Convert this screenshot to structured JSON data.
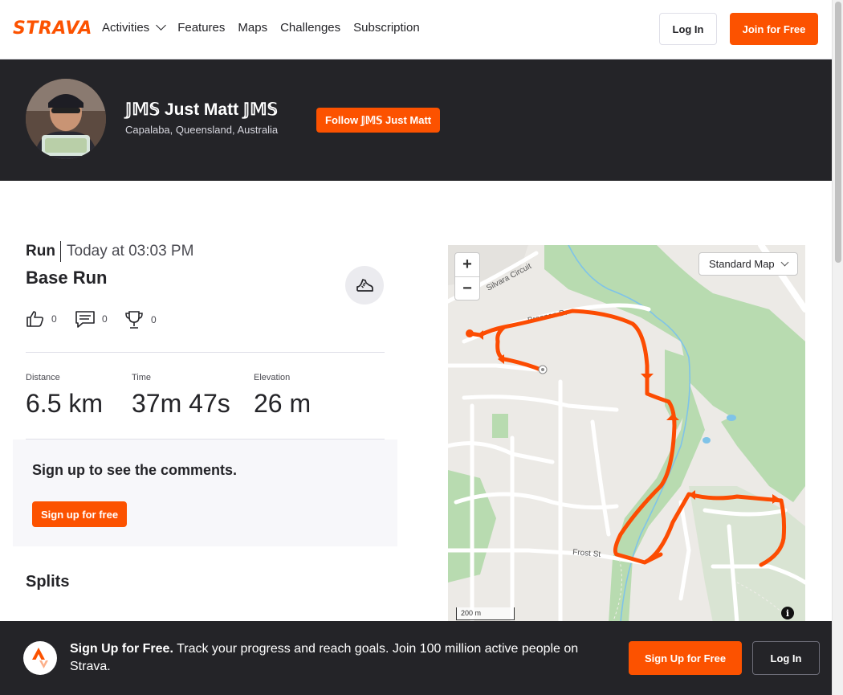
{
  "nav": {
    "logo_text": "STRAVA",
    "links": [
      {
        "label": "Activities",
        "has_dropdown": true
      },
      {
        "label": "Features"
      },
      {
        "label": "Maps"
      },
      {
        "label": "Challenges"
      },
      {
        "label": "Subscription"
      }
    ],
    "login_label": "Log In",
    "join_label": "Join for Free",
    "accent_color": "#fc5200"
  },
  "athlete": {
    "name": "𝕁𝕄𝕊 Just Matt 𝕁𝕄𝕊",
    "location": "Capalaba, Queensland, Australia",
    "follow_label": "Follow 𝕁𝕄𝕊 Just Matt"
  },
  "activity": {
    "type": "Run",
    "time": "Today at 03:03 PM",
    "name": "Base Run",
    "kudos_count": "0",
    "comments_count": "0",
    "achievements_count": "0",
    "stats": [
      {
        "label": "Distance",
        "value": "6.5 km"
      },
      {
        "label": "Time",
        "value": "37m 47s"
      },
      {
        "label": "Elevation",
        "value": "26 m"
      }
    ]
  },
  "comments": {
    "title": "Sign up to see the comments.",
    "signup_label": "Sign up for free"
  },
  "splits": {
    "title": "Splits"
  },
  "map": {
    "type_label": "Standard Map",
    "zoom_in": "+",
    "zoom_out": "−",
    "scale_label": "200 m",
    "streets": [
      "Silvara Circuit",
      "Brosnan Dr",
      "Frost St"
    ],
    "route_color": "#fc4c02",
    "park_color": "#b8dbb0",
    "water_color": "#7fc3e8"
  },
  "banner": {
    "headline": "Sign Up for Free.",
    "text": "Track your progress and reach goals. Join 100 million active people on Strava.",
    "signup_label": "Sign Up for Free",
    "login_label": "Log In"
  }
}
